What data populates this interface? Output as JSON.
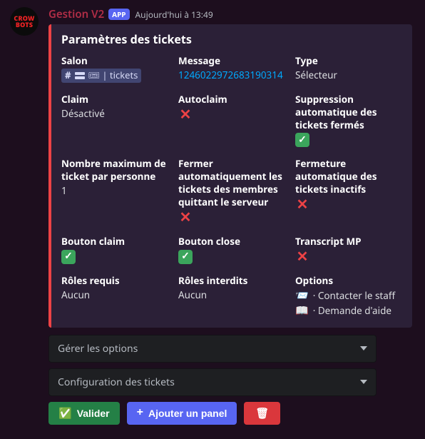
{
  "author": "Gestion V2",
  "badge": "APP",
  "timestamp": "Aujourd'hui à 13:49",
  "avatar": {
    "line1": "CROW",
    "line2": "BOTS"
  },
  "embed": {
    "title": "Paramètres des tickets",
    "fields": {
      "salon": {
        "name": "Salon",
        "channel_name": "🎟 | tickets"
      },
      "message": {
        "name": "Message",
        "value": "1246022972683190314"
      },
      "type": {
        "name": "Type",
        "value": "Sélecteur"
      },
      "claim": {
        "name": "Claim",
        "value": "Désactivé"
      },
      "autoclaim": {
        "name": "Autoclaim"
      },
      "supp_auto": {
        "name": "Suppression automatique des tickets fermés"
      },
      "max": {
        "name": "Nombre maximum de ticket par personne",
        "value": "1"
      },
      "close_leave": {
        "name": "Fermer automatiquement les tickets des membres quittant le serveur"
      },
      "close_inactive": {
        "name": "Fermeture automatique des tickets inactifs"
      },
      "btn_claim": {
        "name": "Bouton claim"
      },
      "btn_close": {
        "name": "Bouton close"
      },
      "transcript": {
        "name": "Transcript MP"
      },
      "roles_req": {
        "name": "Rôles requis",
        "value": "Aucun"
      },
      "roles_forbid": {
        "name": "Rôles interdits",
        "value": "Aucun"
      },
      "options": {
        "name": "Options",
        "line1": "· Contacter le staff",
        "line2": "· Demande d'aide"
      }
    }
  },
  "selects": {
    "s1": "Gérer les options",
    "s2": "Configuration des tickets"
  },
  "buttons": {
    "validate": "Valider",
    "add_panel": "Ajouter un panel"
  }
}
